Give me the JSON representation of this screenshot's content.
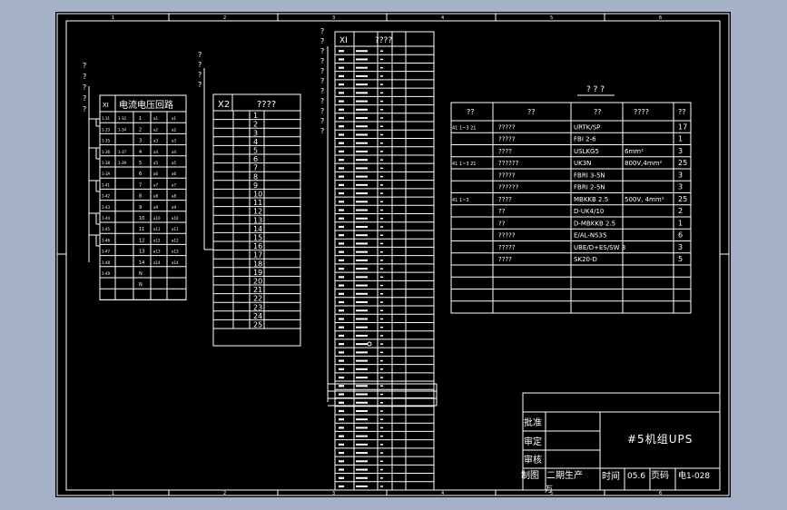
{
  "colors": {
    "background": "#a4b1c6",
    "sheet": "#000000",
    "lines": "#ffffff"
  },
  "title_block": {
    "title": "#5机组UPS",
    "approve_label": "批准",
    "review_label": "审定",
    "check_label": "审核",
    "draw_label": "制图",
    "stage_label": "二期生产",
    "time_label": "时间",
    "time_value": "05.6",
    "page_label": "页码",
    "drawing_no": "电1-028",
    "draw_sign": "万"
  },
  "frame": {
    "top_ticks": [
      "1",
      "2",
      "3",
      "4",
      "5",
      "6"
    ],
    "bottom_ticks": [
      "1",
      "2",
      "3",
      "4",
      "5",
      "6"
    ]
  },
  "strip_x1": {
    "header": [
      "XI",
      "电流电压回路"
    ],
    "rows": [
      [
        "1-31",
        "1-32",
        "1",
        "a1"
      ],
      [
        "1-33",
        "1-34",
        "2",
        "a2"
      ],
      [
        "1-35",
        "",
        "3",
        "a3"
      ],
      [
        "1-36",
        "1-37",
        "4",
        "a4"
      ],
      [
        "1-38",
        "1-39",
        "5",
        "a5"
      ],
      [
        "1-3A",
        "",
        "6",
        "a6"
      ],
      [
        "1-41",
        "",
        "7",
        "a7"
      ],
      [
        "1-42",
        "",
        "8",
        "a8"
      ],
      [
        "1-43",
        "",
        "9",
        "a9"
      ],
      [
        "1-44",
        "",
        "10",
        "a10"
      ],
      [
        "1-45",
        "",
        "11",
        "a11"
      ],
      [
        "1-46",
        "",
        "12",
        "a12"
      ],
      [
        "1-47",
        "",
        "13",
        "a13"
      ],
      [
        "1-48",
        "",
        "14",
        "a14"
      ],
      [
        "1-49",
        "",
        "N",
        ""
      ],
      [
        "",
        "",
        "N",
        ""
      ],
      [
        "",
        "",
        "",
        ""
      ]
    ]
  },
  "strip_x2": {
    "header": [
      "X2",
      "????"
    ],
    "rows": [
      "1",
      "2",
      "3",
      "4",
      "5",
      "6",
      "7",
      "8",
      "9",
      "10",
      "11",
      "12",
      "13",
      "14",
      "15",
      "16",
      "17",
      "18",
      "19",
      "20",
      "21",
      "22",
      "23",
      "24",
      "25"
    ]
  },
  "strip_x3": {
    "header": [
      "XI",
      "????"
    ],
    "row_count": 53
  },
  "parts_table": {
    "caption": "? ? ?",
    "columns": [
      "??",
      "??",
      "??",
      "????",
      "??"
    ],
    "rows": [
      [
        "41 1~3 21",
        "?????",
        "URTK/SP",
        "",
        "17"
      ],
      [
        "",
        "?????",
        "FBI 2-6",
        "",
        "1"
      ],
      [
        "",
        "????",
        "USLKG5",
        "6mm²",
        "3"
      ],
      [
        "41 1~3 21",
        "??????",
        "UK3N",
        "800V,4mm²",
        "25"
      ],
      [
        "",
        "?????",
        "FBRI 3-5N",
        "",
        "3"
      ],
      [
        "",
        "??????",
        "FBRI 2-5N",
        "",
        "3"
      ],
      [
        "41 1~3",
        "????",
        "MBKKB 2.5",
        "500V, 4mm²",
        "25"
      ],
      [
        "",
        "??",
        "D-UK4/10",
        "",
        "2"
      ],
      [
        "",
        "??",
        "D-MBKKB 2.5",
        "",
        "1"
      ],
      [
        "",
        "?????",
        "E/AL-NS35",
        "",
        "6"
      ],
      [
        "",
        "?????",
        "UBE/D+ES/SW 3",
        "",
        "3"
      ],
      [
        "",
        "????",
        "SK20-D",
        "",
        "5"
      ],
      [
        "",
        "",
        "",
        "",
        ""
      ],
      [
        "",
        "",
        "",
        "",
        ""
      ],
      [
        "",
        "",
        "",
        "",
        ""
      ],
      [
        "",
        "",
        "",
        "",
        ""
      ]
    ]
  },
  "markers": {
    "q": "?"
  }
}
